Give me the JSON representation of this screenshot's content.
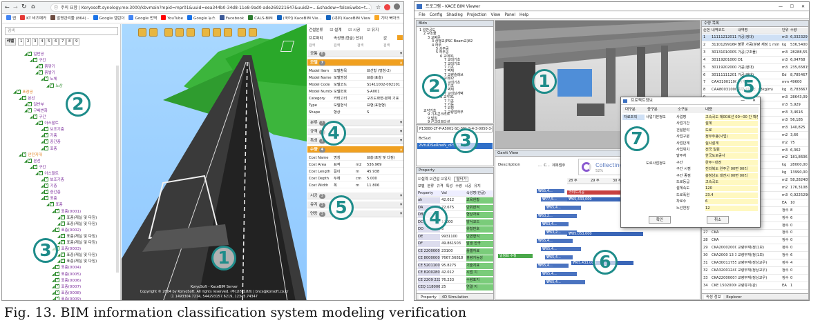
{
  "left_window": {
    "address": "Koryosoft.synology.me:3000/kbvmain?mpid=mpr01&uuid=eea344b0-34d8-11e8-9ad0-ade269221647&uuid2=...&shadow=false&wbs=t...",
    "not_secure": "주의 요함",
    "bookmarks": [
      "앱",
      "KT 비즈메카",
      "발명관리툴 (864) -",
      "Google 캘린더",
      "Google 번역",
      "YouTube",
      "Google 뉴스",
      "Facebook",
      "CALS-BIM",
      "(국어) KaceBIM Vie...",
      "(내부) KaceBIM View",
      "기타 북마크"
    ],
    "bookmark_colors": [
      "#4285f4",
      "#e53935",
      "#6d4c41",
      "#1a73e8",
      "#4285f4",
      "#ff0000",
      "#1a73e8",
      "#3b5998",
      "#2e7d32",
      "#1565c0",
      "#1565c0",
      "#f9a825"
    ],
    "search_placeholder": "검색",
    "levels_label": "레벨",
    "levels": [
      "1",
      "2",
      "3",
      "4",
      "5",
      "6",
      "7",
      "8",
      "9"
    ],
    "tree": [
      {
        "t": "일반공",
        "d": 3,
        "c": "#7a2a9a"
      },
      {
        "t": "구간",
        "d": 4,
        "c": "#7a2a9a"
      },
      {
        "t": "흙깎기",
        "d": 5,
        "c": "#7a2a9a"
      },
      {
        "t": "흙쌓기",
        "d": 5,
        "c": "#7a2a9a"
      },
      {
        "t": "노체",
        "d": 6,
        "c": "#7a2a9a"
      },
      {
        "t": "노상",
        "d": 7,
        "c": "#2a8a2a"
      },
      {
        "t": "포장공",
        "d": 1,
        "c": "#e08020"
      },
      {
        "t": "본선",
        "d": 2,
        "c": "#7a2a9a"
      },
      {
        "t": "일반부",
        "d": 3,
        "c": "#7a2a9a"
      },
      {
        "t": "구배변화",
        "d": 3,
        "c": "#7a2a9a"
      },
      {
        "t": "구간",
        "d": 4,
        "c": "#7a2a9a"
      },
      {
        "t": "아스팔트",
        "d": 5,
        "c": "#7a2a9a"
      },
      {
        "t": "보조기층",
        "d": 6,
        "c": "#7a2a9a"
      },
      {
        "t": "기층",
        "d": 6,
        "c": "#7a2a9a"
      },
      {
        "t": "중간층",
        "d": 6,
        "c": "#7a2a9a"
      },
      {
        "t": "표층",
        "d": 6,
        "c": "#7a2a9a"
      },
      {
        "t": "안전지대",
        "d": 2,
        "c": "#e08020"
      },
      {
        "t": "본선",
        "d": 3,
        "c": "#7a2a9a"
      },
      {
        "t": "구간",
        "d": 4,
        "c": "#7a2a9a"
      },
      {
        "t": "아스팔트",
        "d": 5,
        "c": "#7a2a9a"
      },
      {
        "t": "보조기층",
        "d": 6,
        "c": "#7a2a9a"
      },
      {
        "t": "기층",
        "d": 6,
        "c": "#7a2a9a"
      },
      {
        "t": "중간층",
        "d": 6,
        "c": "#7a2a9a"
      },
      {
        "t": "표층",
        "d": 6,
        "c": "#7a2a9a"
      },
      {
        "t": "표층",
        "d": 7,
        "c": "#7a2a9a"
      },
      {
        "t": "표층(0001)",
        "d": 8,
        "c": "#7a2a9a"
      },
      {
        "t": "표층(재실 및 다짐)",
        "d": 9,
        "c": "#333"
      },
      {
        "t": "표층(재실 및 다짐)",
        "d": 9,
        "c": "#333"
      },
      {
        "t": "표층(0002)",
        "d": 8,
        "c": "#7a2a9a"
      },
      {
        "t": "표층(재실 및 다짐)",
        "d": 9,
        "c": "#333"
      },
      {
        "t": "표층(재실 및 다짐)",
        "d": 9,
        "c": "#333"
      },
      {
        "t": "표층(0003)",
        "d": 8,
        "c": "#7a2a9a"
      },
      {
        "t": "표층(재실 및 다짐)",
        "d": 9,
        "c": "#333"
      },
      {
        "t": "표층(재실 및 다짐)",
        "d": 9,
        "c": "#333"
      },
      {
        "t": "표층(0004)",
        "d": 8,
        "c": "#7a2a9a"
      },
      {
        "t": "표층(0005)",
        "d": 8,
        "c": "#7a2a9a"
      },
      {
        "t": "표층(0006)",
        "d": 8,
        "c": "#7a2a9a"
      },
      {
        "t": "표층(0007)",
        "d": 8,
        "c": "#7a2a9a"
      },
      {
        "t": "표층(0008)",
        "d": 8,
        "c": "#7a2a9a"
      },
      {
        "t": "표층(0009)",
        "d": 8,
        "c": "#7a2a9a"
      }
    ],
    "viewer_footer": [
      "KoryoSoft - KaceBIM Server",
      "Copyright © 2004 by KoryoSoft. All rights reserved. (주)고려소프트 | bncs@korsoft.co.kr",
      "ⓘ 1493304.7214, 544293157.6219, 12345.74347"
    ],
    "props_top": {
      "tabs": [
        "건설분류",
        "설계",
        "시공",
        "유지"
      ],
      "project_label": "프로퍼티",
      "project_value": "속성명(한글) 단위",
      "value_header": "값",
      "sub": [
        "검색",
        "검색",
        "검색",
        "검색"
      ]
    },
    "sections": [
      {
        "title": "공통",
        "n": "8",
        "orange": false
      },
      {
        "title": "모델",
        "n": "7",
        "orange": true
      },
      {
        "title": "분류",
        "n": "7",
        "orange": false
      },
      {
        "title": "규격",
        "n": "3",
        "orange": false
      },
      {
        "title": "특성",
        "n": "1",
        "orange": false
      },
      {
        "title": "수량",
        "n": "4",
        "orange": true
      },
      {
        "title": "시공",
        "n": "3",
        "orange": false
      },
      {
        "title": "유지",
        "n": "3",
        "orange": false
      },
      {
        "title": "연동",
        "n": "3",
        "orange": false
      }
    ],
    "model_rows": [
      [
        "Model Item",
        "모델항목",
        "",
        "표선형 (명칭-2)"
      ],
      [
        "Model Name",
        "모델명칭",
        "",
        "표층(표층)"
      ],
      [
        "Model Code",
        "모델코드",
        "",
        "S1411002-092101"
      ],
      [
        "Model Number",
        "모델번호",
        "",
        "S-A001"
      ],
      [
        "Category",
        "카테고리",
        "",
        "구조도화면-본체 기표"
      ],
      [
        "Type",
        "모델형식",
        "",
        "표형(표형형)"
      ],
      [
        "Shape",
        "형상",
        "",
        "S"
      ]
    ],
    "qty_rows": [
      [
        "Cost Name",
        "명칭",
        "",
        "표층(포장 및 다짐)"
      ],
      [
        "Cost Area",
        "표적",
        "m2",
        "536.969"
      ],
      [
        "Cost Length",
        "길이",
        "m",
        "45.938"
      ],
      [
        "Cost Depth",
        "두께",
        "cm",
        "5.000"
      ],
      [
        "Cost Width",
        "폭",
        "m",
        "11.806"
      ]
    ]
  },
  "right_window": {
    "title": "KACE BIM Viewer",
    "app_name": "프로그램",
    "menu": [
      "File",
      "Config",
      "Shading",
      "Projection",
      "View",
      "Panel",
      "Help"
    ],
    "bldn_label": "Bldn",
    "tree": [
      {
        "t": "1 일반공도",
        "d": 0
      },
      {
        "t": "2 구조물",
        "d": 1
      },
      {
        "t": "3 교량문",
        "d": 2
      },
      {
        "t": "3 상행교(PSC Beam교)82",
        "d": 3
      },
      {
        "t": "4 하부",
        "d": 3
      },
      {
        "t": "5 상부공",
        "d": 4
      },
      {
        "t": "5 하부공",
        "d": 4
      },
      {
        "t": "6 교대01",
        "d": 5
      },
      {
        "t": "7 교대기초",
        "d": 6
      },
      {
        "t": "7 교대기초",
        "d": 6
      },
      {
        "t": "7 기초",
        "d": 6
      },
      {
        "t": "7 벽체",
        "d": 6
      },
      {
        "t": "7 교량슬래브",
        "d": 6
      },
      {
        "t": "6 교대02",
        "d": 5
      },
      {
        "t": "7 교대기초",
        "d": 6
      },
      {
        "t": "7 기초",
        "d": 6
      },
      {
        "t": "7 벽체",
        "d": 6
      },
      {
        "t": "7 교대날개벽",
        "d": 6
      },
      {
        "t": "6 교각01",
        "d": 5
      },
      {
        "t": "7 기초",
        "d": 6
      },
      {
        "t": "7 기둥",
        "d": 6
      },
      {
        "t": "7 코핑",
        "d": 6
      },
      {
        "t": "7 교량점하부",
        "d": 6
      }
    ],
    "tree2": [
      "교각기초",
      "9 기초콘크리트",
      "9 받침",
      "9 콘크리트타설"
    ],
    "combo_value": "P13000-2F-P-A5001-SC-001-S-4-3-0050-3-SGN-00...",
    "list_items": [
      "BcSud",
      "2VtUDSeRheN_cP3DWP3"
    ],
    "property": {
      "title": "Property",
      "checks": [
        "설계",
        "건설",
        "유지"
      ],
      "filter_btn": "필터가",
      "tabs": [
        "모델",
        "분류",
        "규격",
        "특성",
        "수량",
        "시공",
        "유지"
      ],
      "col1": "Property",
      "col2": "Val",
      "col3": "속성명(한글)",
      "rows": [
        [
          "ah",
          "42.012",
          "교육현황"
        ],
        [
          "DA",
          "72.675",
          "단위면적"
        ],
        [
          "DB",
          "",
          "형상자료"
        ],
        [
          "DC",
          "10000",
          "방식코드"
        ],
        [
          "DD",
          "5",
          "유형번호"
        ],
        [
          "DE",
          "9931100",
          "단면형식"
        ],
        [
          "DF",
          "49.861503",
          "발생 한국"
        ],
        [
          "CE 2200000",
          "23100",
          "종별자료"
        ],
        [
          "CE 8000000",
          "7667.56818",
          "불량가능성"
        ],
        [
          "CE 52011000",
          "95.8275",
          "기술지표"
        ],
        [
          "CE 82002800",
          "42.012",
          "시범 지"
        ],
        [
          "CE 2209 2226",
          "76.233",
          "수량표지"
        ],
        [
          "CEQ 1180008",
          "25",
          "연결 지"
        ]
      ],
      "bottom_tabs": [
        "Property",
        "4D Simulation"
      ]
    },
    "gantt": {
      "title": "Gantt View",
      "desc_header": "Description",
      "cols": [
        "...",
        "C...",
        "제목범주"
      ],
      "collecting": "Collecting...",
      "pct": "52%",
      "weeks": [
        "28 주",
        "29 주",
        "30 주",
        "31 주",
        "32 주",
        "33 주"
      ],
      "bar_labels": [
        "₩65,4...",
        "₩77,5...",
        "₩65,4...",
        "₩63,2...",
        "₩63,4...",
        "₩63,2...",
        "₩65,4...",
        "₩65,4...",
        "₩65,4...",
        "₩65,4...",
        "₩65,4...",
        "₩65,4..."
      ],
      "red_bar": "가이드시공",
      "amt1": "₩65,433,000",
      "amt2": "₩85,053,000",
      "amt3": "₩65,433,000",
      "green_label": "일정표 수정"
    },
    "qty_table": {
      "title": "수량 목록",
      "headers": [
        "순번",
        "내역코드",
        "내역명",
        "단위",
        "수량"
      ],
      "rows": [
        [
          "1",
          "1111121201142524",
          "가공(정대)",
          "m3",
          "6,332329"
        ],
        [
          "2",
          "3110129916R00O",
          "불꽃 가공(분량 재정 1 m/m)",
          "kg",
          "536,5400"
        ],
        [
          "3",
          "3013101000SO003",
          "가공(구조물)",
          "m3",
          "28288,55"
        ],
        [
          "4",
          "3011920100007",
          "D1",
          "m3",
          "6,04768"
        ],
        [
          "5",
          "3011920200007",
          "가공(정대)",
          "m3",
          "235,65815"
        ],
        [
          "6",
          "3011111120142503",
          "가공(정대)",
          "Ed",
          "8,785467"
        ],
        [
          "7",
          "CAA310011000",
          "원(제공)",
          "mm",
          "49600"
        ],
        [
          "8",
          "CAA800310000",
          "종편(이방형, 63kg/m)",
          "kg",
          "8,783667"
        ],
        [
          "9",
          "",
          "",
          "m3",
          "28643,09"
        ],
        [
          "10",
          "",
          "",
          "m3",
          "5,929"
        ],
        [
          "11",
          "",
          "",
          "m3",
          "3,4616"
        ],
        [
          "12",
          "",
          "",
          "m3",
          "56,185"
        ],
        [
          "13",
          "",
          "",
          "m3",
          "140,825"
        ],
        [
          "14",
          "",
          "",
          "m2",
          "3,66"
        ],
        [
          "15",
          "",
          "",
          "m2",
          "75"
        ],
        [
          "16",
          "",
          "",
          "m3",
          "6,362"
        ],
        [
          "17",
          "",
          "",
          "m2",
          "181,8606"
        ],
        [
          "18",
          "",
          "",
          "kg",
          "28000,00"
        ],
        [
          "19",
          "",
          "",
          "kg",
          "13990,00"
        ],
        [
          "20",
          "",
          "",
          "m2",
          "58,282405"
        ],
        [
          "21",
          "",
          "",
          "m2",
          "176,3108"
        ],
        [
          "22",
          "",
          "",
          "m3",
          "0,92252984"
        ],
        [
          "23",
          "",
          "",
          "EA",
          "10"
        ],
        [
          "24",
          "",
          "",
          "정수",
          "8"
        ],
        [
          "25",
          "",
          "",
          "정수",
          "6"
        ],
        [
          "26",
          "",
          "",
          "정수",
          "0"
        ],
        [
          "27",
          "CKA",
          "",
          "정수",
          "0"
        ],
        [
          "28",
          "CKA",
          "",
          "정수",
          "0"
        ],
        [
          "29",
          "CKA2000200000",
          "교량부재(정(1보)",
          "정수",
          "0"
        ],
        [
          "30",
          "CKA2000 13 32",
          "교량부재(정(1보)",
          "정수",
          "6"
        ],
        [
          "31",
          "CKA300117550",
          "교량부재(정상교우)",
          "정수",
          "4"
        ],
        [
          "32",
          "CKA32001240",
          "교량부재(정상교우)",
          "정수",
          "0"
        ],
        [
          "33",
          "CKA22000007",
          "교량부재(정상교우)",
          "정수",
          "0"
        ],
        [
          "34",
          "CKE 15020000",
          "교량유지(관)",
          "EA",
          "1"
        ]
      ],
      "bottom_tabs": [
        "속성 정보",
        "Explorer"
      ]
    },
    "dialog": {
      "title": "프로젝트정보",
      "headers": [
        "대구분",
        "중구분",
        "소구분",
        "내용"
      ],
      "left_label": "자료조직",
      "mid_label": "사업기본정보",
      "mid2": "도로사업정보",
      "rows": [
        [
          "사업명",
          "고속국도 제00호선 00~00 간 확장공사"
        ],
        [
          "사업기간",
          "설계"
        ],
        [
          "건설분야",
          "도로"
        ],
        [
          "사업구분",
          "정부주용(사업)"
        ],
        [
          "사업단계",
          "실시설계"
        ],
        [
          "사업위치",
          "전국 일원"
        ],
        [
          "발주처",
          "한국도로공사"
        ],
        [
          "구간",
          "완주~대전"
        ],
        [
          "구간 시점",
          "전라북도 완주군 00면 00리"
        ],
        [
          "구간 종점",
          "충청남도 대전시 00면 00리"
        ],
        [
          "도로등급",
          "고속국도"
        ],
        [
          "설계속도",
          "120"
        ],
        [
          "도로폭원",
          "23.4"
        ],
        [
          "차로수",
          "6"
        ],
        [
          "노선연장",
          "12"
        ]
      ],
      "ok": "확인",
      "cancel": "취소"
    }
  },
  "circles": [
    "1",
    "2",
    "3",
    "4",
    "5",
    "1",
    "2",
    "3",
    "4",
    "5",
    "6",
    "7"
  ],
  "caption": "Fig.  13.  BIM  information  classification  system  modeling  verification"
}
